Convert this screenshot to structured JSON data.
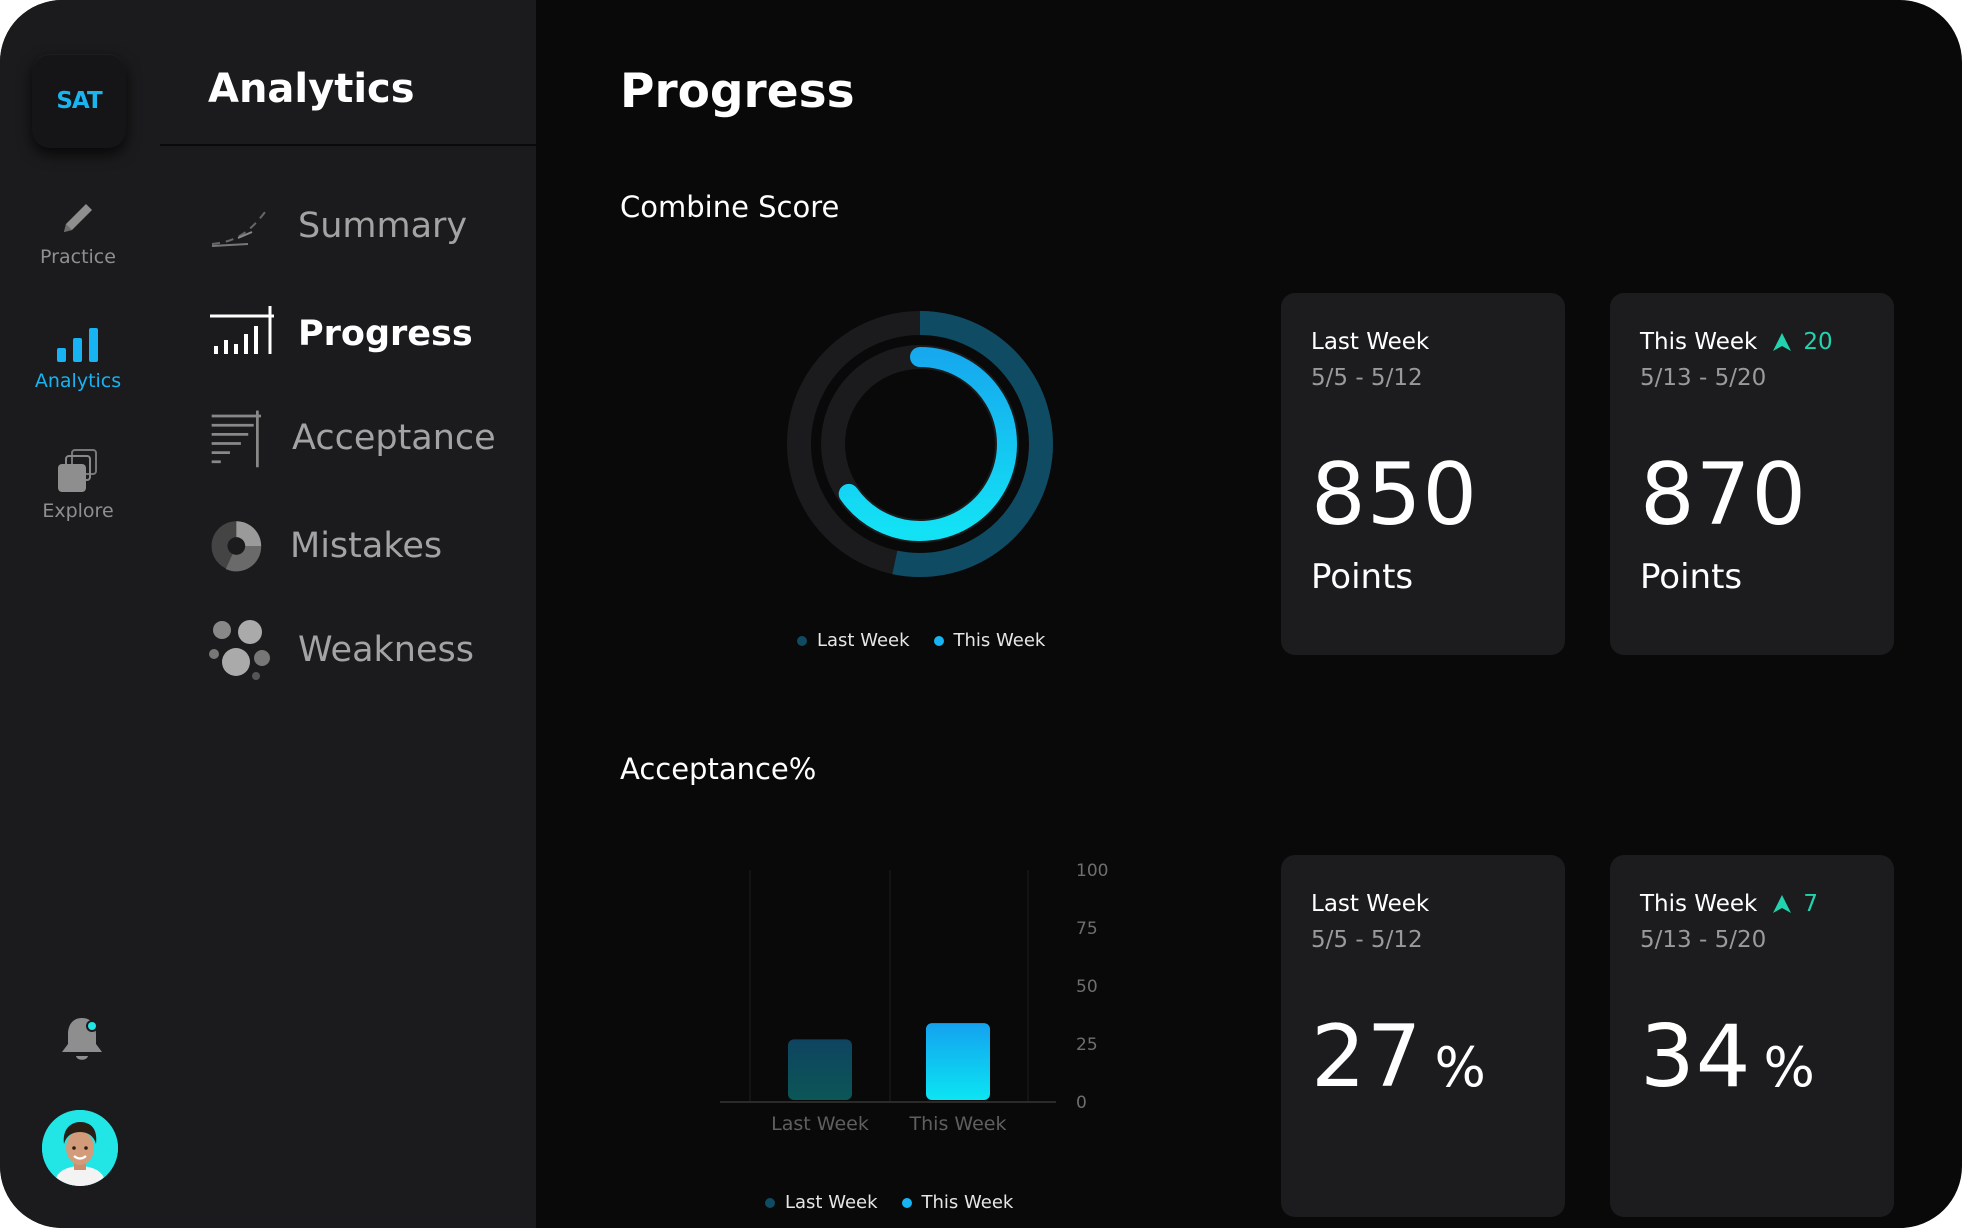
{
  "app": {
    "logo_text": "SAT"
  },
  "rail": {
    "items": [
      {
        "label": "Practice",
        "icon": "pencil-icon"
      },
      {
        "label": "Analytics",
        "icon": "bar-chart-icon",
        "active": true
      },
      {
        "label": "Explore",
        "icon": "cards-stack-icon"
      }
    ]
  },
  "subnav": {
    "title": "Analytics",
    "items": [
      {
        "label": "Summary",
        "icon": "trend-curve-icon"
      },
      {
        "label": "Progress",
        "icon": "progress-bars-icon",
        "active": true
      },
      {
        "label": "Acceptance",
        "icon": "lines-icon"
      },
      {
        "label": "Mistakes",
        "icon": "pie-icon"
      },
      {
        "label": "Weakness",
        "icon": "bubbles-icon"
      }
    ]
  },
  "main": {
    "title": "Progress",
    "combine": {
      "title": "Combine Score",
      "legend": [
        "Last Week",
        "This Week"
      ],
      "cards": [
        {
          "title": "Last Week",
          "dates": "5/5 - 5/12",
          "value": "850",
          "unit": "Points"
        },
        {
          "title": "This Week",
          "dates": "5/13 - 5/20",
          "value": "870",
          "unit": "Points",
          "trend": "20"
        }
      ]
    },
    "acceptance": {
      "title": "Acceptance%",
      "legend": [
        "Last Week",
        "This Week"
      ],
      "cards": [
        {
          "title": "Last Week",
          "dates": "5/5 - 5/12",
          "value": "27",
          "unit": "%"
        },
        {
          "title": "This Week",
          "dates": "5/13 - 5/20",
          "value": "34",
          "unit": "%",
          "trend": "7"
        }
      ]
    }
  },
  "colors": {
    "accent": "#17b3f2",
    "dark_teal": "#0f4b63",
    "trend": "#22d3b0"
  },
  "chart_data": [
    {
      "type": "radial",
      "series": [
        {
          "name": "Last Week",
          "value": 850
        },
        {
          "name": "This Week",
          "value": 870
        }
      ],
      "legend": [
        "Last Week",
        "This Week"
      ]
    },
    {
      "type": "bar",
      "categories": [
        "Last Week",
        "This Week"
      ],
      "values": [
        27,
        34
      ],
      "yticks": [
        "100",
        "75",
        "50",
        "25",
        "0"
      ],
      "ylim": [
        0,
        100
      ],
      "legend": [
        "Last Week",
        "This Week"
      ]
    }
  ]
}
